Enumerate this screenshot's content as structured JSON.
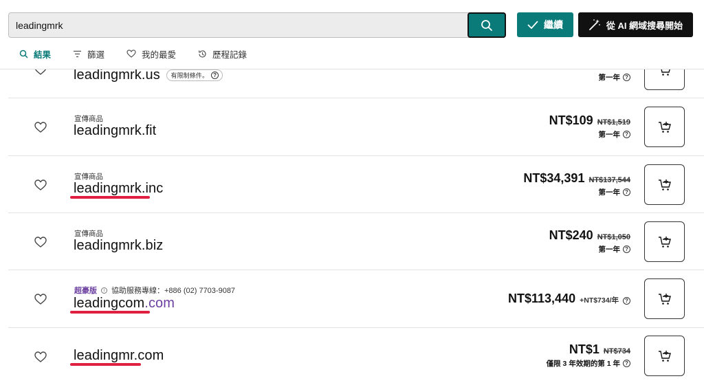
{
  "search": {
    "value": "leadingmrk"
  },
  "buttons": {
    "continue": "繼續",
    "ai": "從 AI 網域搜尋開始"
  },
  "tabs": [
    {
      "label": "結果",
      "icon": "search-icon"
    },
    {
      "label": "篩選",
      "icon": "filter-icon"
    },
    {
      "label": "我的最愛",
      "icon": "heart-icon"
    },
    {
      "label": "歷程記錄",
      "icon": "history-icon"
    }
  ],
  "results": [
    {
      "domain": "leadingmrk.us",
      "restriction": "有限制條件。",
      "term": "第一年"
    },
    {
      "promo": "宣傳商品",
      "domain": "leadingmrk.fit",
      "price": "NT$109",
      "original": "NT$1,519",
      "term": "第一年"
    },
    {
      "promo": "宣傳商品",
      "domain": "leadingmrk.inc",
      "price": "NT$34,391",
      "original": "NT$137,544",
      "term": "第一年"
    },
    {
      "promo": "宣傳商品",
      "domain": "leadingmrk.biz",
      "price": "NT$240",
      "original": "NT$1,050",
      "term": "第一年"
    },
    {
      "premium": "超豪版",
      "support": "協助服務專線：+886 (02) 7703-9087",
      "domain_main": "leadingcom",
      "domain_tld": ".com",
      "price": "NT$113,440",
      "renewal": "+NT$734/年"
    },
    {
      "domain": "leadingmr.com",
      "price": "NT$1",
      "original": "NT$734",
      "term": "僅限 3 年效期的第 1 年"
    }
  ],
  "colors": {
    "accent": "#0b7b7a",
    "premium": "#6b3fa0",
    "highlight": "#e02040",
    "dark_button": "#111111"
  }
}
